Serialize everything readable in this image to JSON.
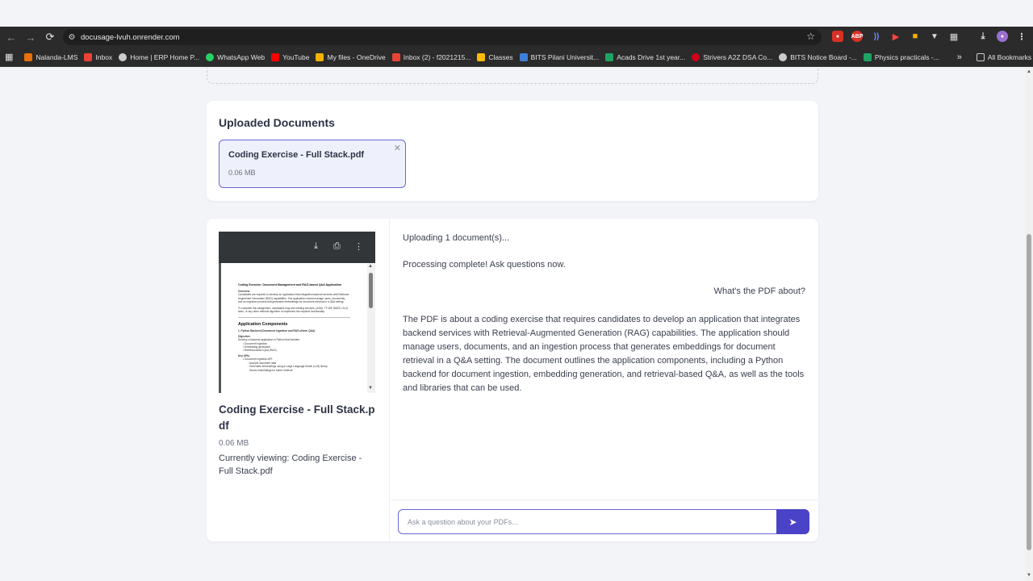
{
  "browser": {
    "url": "docusage-lvuh.onrender.com",
    "bookmarks": [
      {
        "label": "Nalanda-LMS",
        "color": "#e8710a"
      },
      {
        "label": "Inbox",
        "color": "#ea4335"
      },
      {
        "label": "Home | ERP Home P...",
        "color": "#cccccc"
      },
      {
        "label": "WhatsApp Web",
        "color": "#25d366"
      },
      {
        "label": "YouTube",
        "color": "#ff0000"
      },
      {
        "label": "My files - OneDrive",
        "color": "#f2b200"
      },
      {
        "label": "Inbox (2) - f2021215...",
        "color": "#ea4335"
      },
      {
        "label": "Classes",
        "color": "#f9bc05"
      },
      {
        "label": "BITS Pilani Universit...",
        "color": "#3f7fd8"
      },
      {
        "label": "Acads Drive 1st year...",
        "color": "#1fa463"
      },
      {
        "label": "Strivers A2Z DSA Co...",
        "color": "#d0021b"
      },
      {
        "label": "BITS Notice Board -...",
        "color": "#cccccc"
      },
      {
        "label": "Physics practicals -...",
        "color": "#1fa463"
      }
    ],
    "more_label": "»",
    "all_bookmarks": "All Bookmarks"
  },
  "uploaded": {
    "title": "Uploaded Documents",
    "doc_name": "Coding Exercise - Full Stack.pdf",
    "doc_size": "0.06 MB"
  },
  "pdf_preview": {
    "heading": "Coding Exercise: Document Management and RAG-based Q&A Application",
    "overview_label": "Overview",
    "overview_text": "Candidates are required to develop an application that integrates backend services with Retrieval-Augmented Generation (RAG) capabilities. This application should manage users, documents, and an ingestion process that generates embeddings for document retrieval in a Q&A setting.",
    "note_text": "To complete this assignment, candidates may use existing services, (AOAI, TF-IDF, BM25, OLLI) learn, or any other retrieval algorithm to implement the required functionality.",
    "section_title": "Application Components",
    "subsection": "1. Python Backend (Document Ingestion and RAG-driven Q&A)",
    "objective_label": "Objective:",
    "objective_text": "Develop a backend application in Python that handles:",
    "bullets": [
      "Document ingestion",
      "Embedding generation",
      "Retrieval-based Q&A (RAG)"
    ],
    "key_apis": "Key APIs:",
    "api1": "Document Ingestion API:",
    "api1_sub": [
      "Accepts document data",
      "Generates embeddings using a Large Language Model (LLM) library",
      "Stores embeddings for future retrieval"
    ]
  },
  "side": {
    "title": "Coding Exercise - Full Stack.pdf",
    "size": "0.06 MB",
    "current": "Currently viewing: Coding Exercise - Full Stack.pdf"
  },
  "chat": {
    "messages": [
      "Uploading 1 document(s)...",
      "Processing complete! Ask questions now.",
      "What's the PDF about?",
      "The PDF is about a coding exercise that requires candidates to develop an application that integrates backend services with Retrieval-Augmented Generation (RAG) capabilities. The application should manage users, documents, and an ingestion process that generates embeddings for document retrieval in a Q&A setting. The document outlines the application components, including a Python backend for document ingestion, embedding generation, and retrieval-based Q&A, as well as the tools and libraries that can be used."
    ],
    "placeholder": "Ask a question about your PDFs..."
  },
  "colors": {
    "accent": "#4a43c7",
    "chip_border": "#6b66d8",
    "chip_bg": "#eef1fb",
    "page_bg": "#f3f4f8"
  },
  "icons": {
    "back": "arrow-left-icon",
    "forward": "arrow-right-icon",
    "reload": "reload-icon",
    "site_info": "site-info-icon",
    "star": "star-icon",
    "apps": "apps-grid-icon",
    "close": "close-icon",
    "download": "download-icon",
    "print": "print-icon",
    "more": "more-vertical-icon",
    "send": "send-icon"
  }
}
